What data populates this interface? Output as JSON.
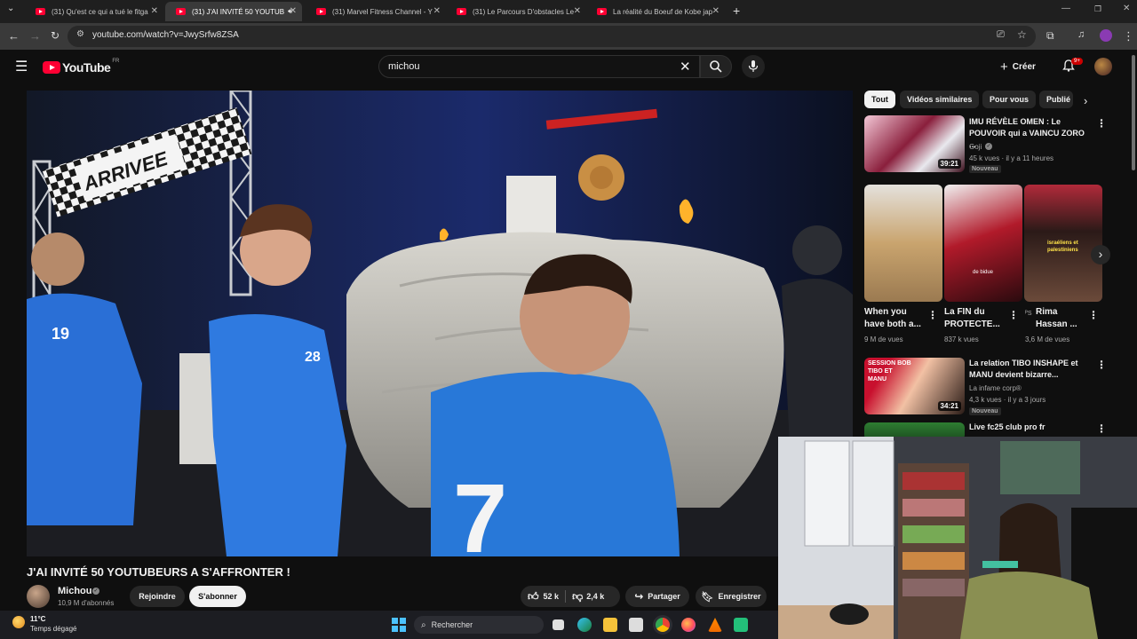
{
  "browser": {
    "tabs": [
      {
        "label": "(31) Qu'est ce qui a tué le fitga",
        "active": false
      },
      {
        "label": "(31) J'AI INVITÉ 50 YOUTUB",
        "active": true
      },
      {
        "label": "(31) Marvel Fitness Channel - Y",
        "active": false
      },
      {
        "label": "(31) Le Parcours D'obstacles Le",
        "active": false
      },
      {
        "label": "La réalité du Boeuf de Kobe jap",
        "active": false
      }
    ],
    "new_tab": "+",
    "url": "youtube.com/watch?v=JwySrfw8ZSA"
  },
  "youtube": {
    "logo_text": "YouTube",
    "region": "FR",
    "search_value": "michou",
    "create_label": "Créer",
    "notif_count": "9+"
  },
  "video": {
    "title": "J'AI INVITÉ 50 YOUTUBEURS A S'AFFRONTER !",
    "overlay_arch_text": "ARRIVEE",
    "jersey_numbers": [
      "7",
      "28",
      "19"
    ],
    "channel": "Michou",
    "subscribers": "10,9 M d'abonnés",
    "join_label": "Rejoindre",
    "subscribe_label": "S'abonner",
    "likes": "52 k",
    "dislikes": "2,4 k",
    "share_label": "Partager",
    "save_label": "Enregistrer"
  },
  "chips": [
    "Tout",
    "Vidéos similaires",
    "Pour vous",
    "Publié"
  ],
  "sidebar": {
    "videos": [
      {
        "title": "IMU RÉVÈLE OMEN : Le POUVOIR qui a VAINCU ZORO ...",
        "channel": "Goji",
        "meta": "45 k vues · il y a 11 heures",
        "badge": "Nouveau",
        "duration": "39:21"
      },
      {
        "title": "La relation TIBO INSHAPE et MANU devient bizarre...",
        "channel": "La infame corp®",
        "meta": "4,3 k vues · il y a 3 jours",
        "badge": "Nouveau",
        "duration": "34:21",
        "thumb_text": "SESSION BOB TIBO ET MANU"
      },
      {
        "title": "Live fc25 club pro fr",
        "channel": "",
        "meta": "",
        "badge": "",
        "duration": ""
      }
    ],
    "shorts": [
      {
        "title": "When you have both a...",
        "views": "9 M de vues",
        "overlay": ""
      },
      {
        "title": "La FIN du PROTECTE...",
        "views": "837 k vues",
        "overlay": "de bidue"
      },
      {
        "title": "Rima Hassan ...",
        "views": "3,6 M de vues",
        "overlay": "israéliens et palestiniens",
        "prefix": "ᴾS"
      }
    ]
  },
  "taskbar": {
    "temperature": "11°C",
    "weather": "Temps dégagé",
    "search_label": "Rechercher"
  }
}
